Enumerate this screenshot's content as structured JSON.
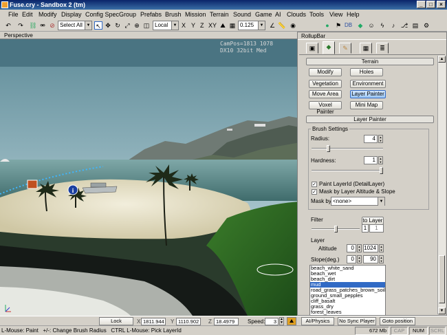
{
  "window": {
    "title": "Fuse.cry - Sandbox 2 (tm)",
    "min": "_",
    "max": "□",
    "close": "×"
  },
  "menu": [
    "File",
    "Edit",
    "Modify",
    "Display",
    "Config Spec",
    "Group",
    "Prefabs",
    "Brush",
    "Mission",
    "Terrain",
    "Sound",
    "Game",
    "AI",
    "Clouds",
    "Tools",
    "View",
    "Help"
  ],
  "toolbar": {
    "select_filter": "Select All",
    "coord_system": "Local",
    "axes": [
      "X",
      "Y",
      "Z",
      "XY"
    ],
    "grid_value": "0.125",
    "db_label": "DB"
  },
  "viewport": {
    "label": "Perspective",
    "hud_line1": "CamPos=1813 1078",
    "hud_line2": "DX10 32bit Med"
  },
  "rollup": {
    "title": "RollupBar",
    "terrain_bar": "Terrain",
    "buttons": {
      "modify": "Modify",
      "holes": "Holes",
      "vegetation": "Vegetation",
      "environment": "Environment",
      "move_area": "Move Area",
      "layer_painter": "Layer Painter",
      "voxel_painter": "Voxel Painter",
      "mini_map": "Mini Map"
    },
    "layer_painter_bar": "Layer Painter",
    "brush_settings": "Brush Settings",
    "radius_label": "Radius:",
    "radius_value": "4",
    "hardness_label": "Hardness:",
    "hardness_value": "1",
    "paint_layerid": "Paint LayerId (DetailLayer)",
    "mask_altitude": "Mask by Layer Altitude & Slope",
    "mask_by_label": "Mask by",
    "mask_by_value": "<none>",
    "filter_label": "Filter",
    "to_layer": "to Layer",
    "filter_min": "1",
    "filter_max": "1",
    "layer_label": "Layer",
    "altitude_label": "Altitude",
    "altitude_min": "0",
    "altitude_max": "1024",
    "slope_label": "Slope(deg.)",
    "slope_min": "0",
    "slope_max": "90",
    "layers": [
      "beach_white_sand",
      "beach_wet",
      "beach_dirt",
      "mud",
      "road_grass_patches_brown_soil",
      "ground_small_pepples",
      "cliff_basalt",
      "grass_dry",
      "forest_leaves"
    ],
    "selected_layer": "mud"
  },
  "status": {
    "lock_selection": "Lock Selection",
    "x_label": "X",
    "x_value": "1811.944",
    "y_label": "Y",
    "y_value": "1110.902",
    "z_label": "Z",
    "z_value": "18.4979",
    "speed_label": "Speed:",
    "speed_value": "3",
    "ai_physics": "AI/Physics",
    "no_sync": "No Sync Player",
    "goto_position": "Goto position",
    "hint": "L-Mouse: Paint   +/-: Change Brush Radius   CTRL L-Mouse: Pick LayerId",
    "memory": "672 Mb",
    "cap": "CAP",
    "num": "NUM",
    "scrl": "SCRL"
  }
}
